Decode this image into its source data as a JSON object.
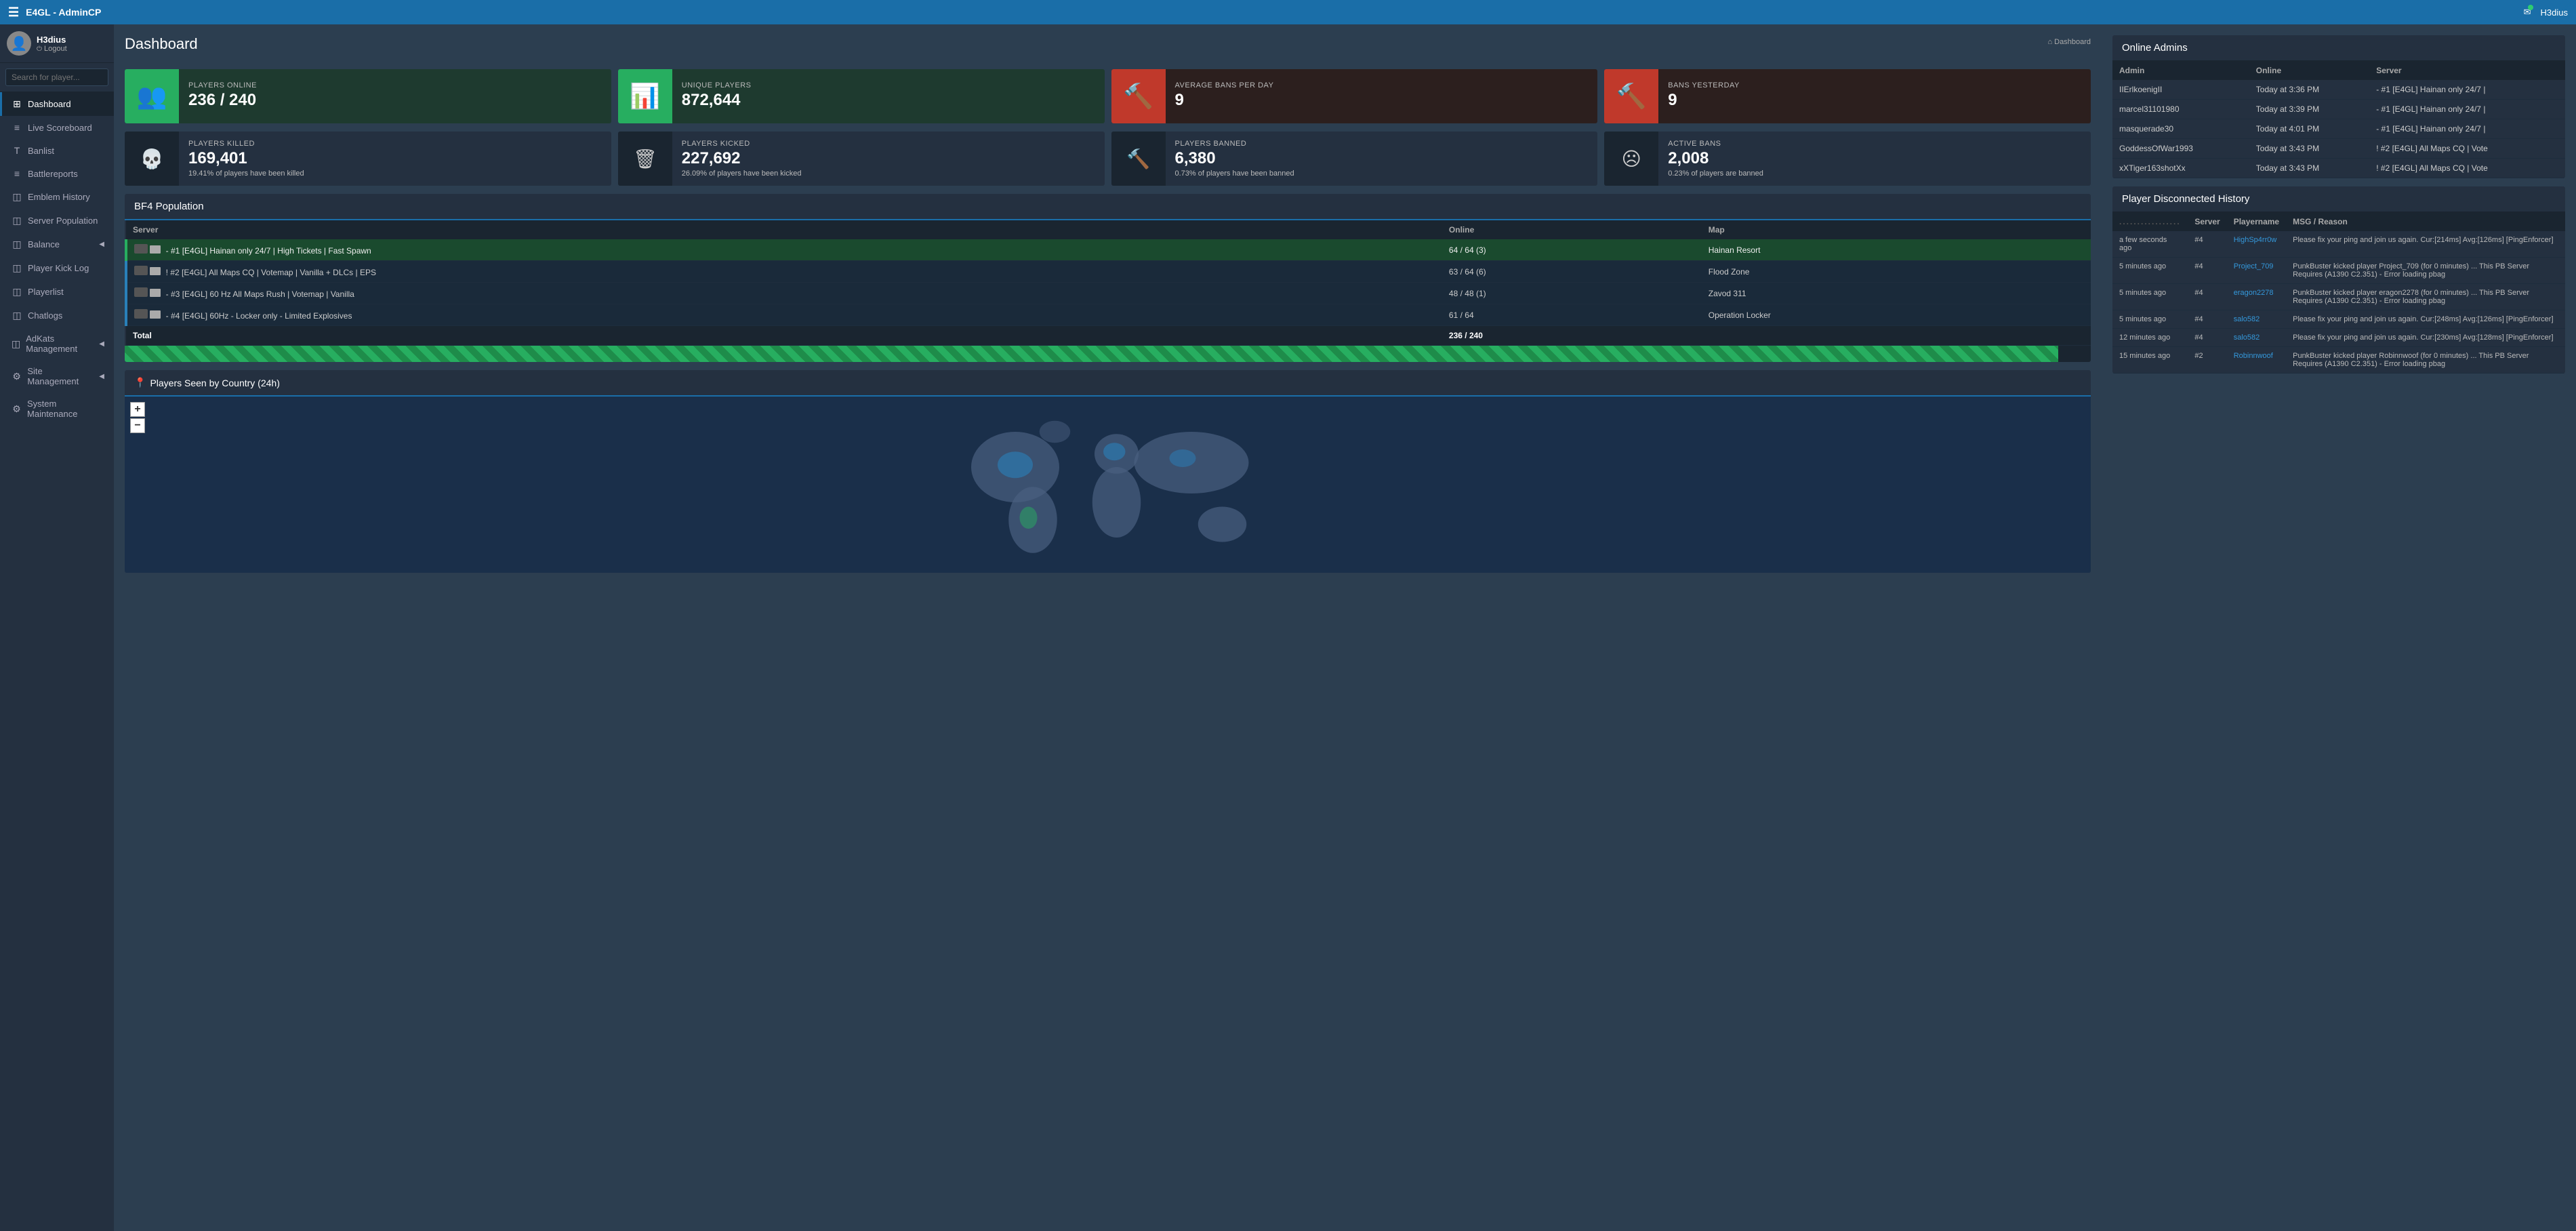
{
  "app": {
    "title": "E4GL - AdminCP",
    "breadcrumb": "Dashboard"
  },
  "topnav": {
    "brand": "E4GL - AdminCP",
    "user": "H3dius",
    "mail_icon": "✉"
  },
  "sidebar": {
    "user": {
      "name": "H3dius",
      "logout": "Logout"
    },
    "search_placeholder": "Search for player...",
    "items": [
      {
        "label": "Dashboard",
        "icon": "⊞",
        "active": true
      },
      {
        "label": "Live Scoreboard",
        "icon": "≡"
      },
      {
        "label": "Banlist",
        "icon": "T"
      },
      {
        "label": "Battlereports",
        "icon": "≡"
      },
      {
        "label": "Emblem History",
        "icon": "◫"
      },
      {
        "label": "Server Population",
        "icon": "◫"
      },
      {
        "label": "Balance",
        "icon": "◫",
        "arrow": "◀"
      },
      {
        "label": "Player Kick Log",
        "icon": "◫"
      },
      {
        "label": "Playerlist",
        "icon": "◫"
      },
      {
        "label": "Chatlogs",
        "icon": "◫"
      },
      {
        "label": "AdKats Management",
        "icon": "◫",
        "arrow": "◀"
      },
      {
        "label": "Site Management",
        "icon": "⚙",
        "arrow": "◀"
      },
      {
        "label": "System Maintenance",
        "icon": "⚙"
      }
    ]
  },
  "dashboard": {
    "title": "Dashboard",
    "stats": [
      {
        "label": "PLAYERS ONLINE",
        "value": "236 / 240",
        "sub": "",
        "icon": "👥",
        "type": "green"
      },
      {
        "label": "UNIQUE PLAYERS",
        "value": "872,644",
        "sub": "",
        "icon": "📊",
        "type": "green"
      },
      {
        "label": "AVERAGE BANS PER DAY",
        "value": "9",
        "sub": "",
        "icon": "🔨",
        "type": "red"
      },
      {
        "label": "BANS YESTERDAY",
        "value": "9",
        "sub": "",
        "icon": "🔨",
        "type": "red"
      },
      {
        "label": "PLAYERS KILLED",
        "value": "169,401",
        "sub": "19.41% of players have been killed",
        "icon": "💀",
        "type": "dark"
      },
      {
        "label": "PLAYERS KICKED",
        "value": "227,692",
        "sub": "26.09% of players have been kicked",
        "icon": "🗑",
        "type": "dark"
      },
      {
        "label": "PLAYERS BANNED",
        "value": "6,380",
        "sub": "0.73% of players have been banned",
        "icon": "🔨",
        "type": "dark"
      },
      {
        "label": "ACTIVE BANS",
        "value": "2,008",
        "sub": "0.23% of players are banned",
        "icon": "☹",
        "type": "dark"
      }
    ],
    "bf4": {
      "title": "BF4 Population",
      "columns": [
        "Server",
        "Online",
        "Map"
      ],
      "servers": [
        {
          "name": "- #1 [E4GL] Hainan only 24/7 | High Tickets | Fast Spawn",
          "online": "64 / 64 (3)",
          "map": "Hainan Resort",
          "style": "green"
        },
        {
          "name": "! #2 [E4GL] All Maps CQ | Votemap | Vanilla + DLCs | EPS",
          "online": "63 / 64 (6)",
          "map": "Flood Zone",
          "style": "blue"
        },
        {
          "name": "- #3 [E4GL] 60 Hz All Maps Rush | Votemap | Vanilla",
          "online": "48 / 48 (1)",
          "map": "Zavod 311",
          "style": "blue"
        },
        {
          "name": "- #4 [E4GL] 60Hz - Locker only - Limited Explosives",
          "online": "61 / 64",
          "map": "Operation Locker",
          "style": "blue"
        }
      ],
      "total_label": "Total",
      "total_value": "236 / 240",
      "progress_pct": "98.33%",
      "progress_width": "98.33"
    },
    "map": {
      "title": "Players Seen by Country (24h)",
      "zoom_in": "+",
      "zoom_out": "-"
    },
    "online_admins": {
      "title": "Online Admins",
      "columns": [
        "Admin",
        "Online",
        "Server"
      ],
      "rows": [
        {
          "admin": "IIErlkoenigII",
          "online": "Today at 3:36 PM",
          "server": "- #1 [E4GL] Hainan only 24/7 |"
        },
        {
          "admin": "marcel31101980",
          "online": "Today at 3:39 PM",
          "server": "- #1 [E4GL] Hainan only 24/7 |"
        },
        {
          "admin": "masquerade30",
          "online": "Today at 4:01 PM",
          "server": "- #1 [E4GL] Hainan only 24/7 |"
        },
        {
          "admin": "GoddessOfWar1993",
          "online": "Today at 3:43 PM",
          "server": "! #2 [E4GL] All Maps CQ | Vote"
        },
        {
          "admin": "xXTiger163shotXx",
          "online": "Today at 3:43 PM",
          "server": "! #2 [E4GL] All Maps CQ | Vote"
        }
      ]
    },
    "disconnected": {
      "title": "Player Disconnected History",
      "columns": [
        ".................",
        "Server",
        "Playername",
        "MSG / Reason"
      ],
      "rows": [
        {
          "time": "a few seconds ago",
          "server": "#4",
          "player": "HighSp4rr0w",
          "msg": "Please fix your ping and join us again. Cur:[214ms] Avg:[126ms] [PingEnforcer]"
        },
        {
          "time": "5 minutes ago",
          "server": "#4",
          "player": "Project_709",
          "msg": "PunkBuster kicked player Project_709 (for 0 minutes) ... This PB Server Requires (A1390 C2.351) - Error loading pbag"
        },
        {
          "time": "5 minutes ago",
          "server": "#4",
          "player": "eragon2278",
          "msg": "PunkBuster kicked player eragon2278 (for 0 minutes) ... This PB Server Requires (A1390 C2.351) - Error loading pbag"
        },
        {
          "time": "5 minutes ago",
          "server": "#4",
          "player": "salo582",
          "msg": "Please fix your ping and join us again. Cur:[248ms] Avg:[126ms] [PingEnforcer]"
        },
        {
          "time": "12 minutes ago",
          "server": "#4",
          "player": "salo582",
          "msg": "Please fix your ping and join us again. Cur:[230ms] Avg:[128ms] [PingEnforcer]"
        },
        {
          "time": "15 minutes ago",
          "server": "#2",
          "player": "Robinnwoof",
          "msg": "PunkBuster kicked player Robinnwoof (for 0 minutes) ... This PB Server Requires (A1390 C2.351) - Error loading pbag"
        }
      ]
    }
  }
}
